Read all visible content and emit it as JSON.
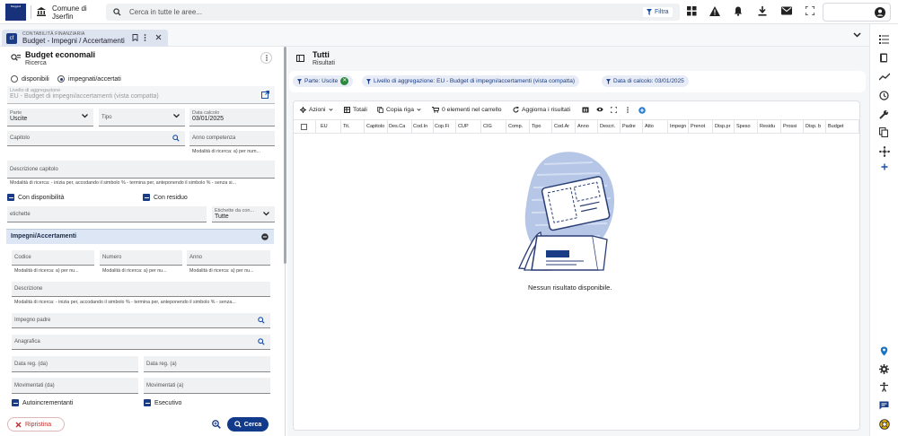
{
  "topbar": {
    "logo_text": "Maggioli",
    "comune_line1": "Comune di",
    "comune_line2": "Jserfin",
    "search_placeholder": "Cerca in tutte le aree...",
    "filtra_label": "Filtra"
  },
  "tab": {
    "badge": "cf",
    "category": "CONTABILITÀ FINANZIARIA",
    "title": "Budget - Impegni / Accertamenti"
  },
  "left": {
    "title": "Budget economali",
    "subtitle": "Ricerca",
    "radio_disponibili": "disponibili",
    "radio_impegnati": "impegnati/accertati",
    "livello": {
      "label": "Livello di aggregazione",
      "value": "EU - Budget di impegni/accertamenti (vista compatta)"
    },
    "parte": {
      "label": "Parte",
      "value": "Uscite"
    },
    "tipo": {
      "label": "Tipo"
    },
    "data_calcolo": {
      "label": "Data calcolo",
      "value": "03/01/2025"
    },
    "capitolo": {
      "placeholder": "Capitolo"
    },
    "anno_competenza": {
      "placeholder": "Anno competenza",
      "hint": "Modalità di ricerca: a) per num..."
    },
    "descrizione_capitolo": {
      "placeholder": "Descrizione capitolo",
      "hint": "Modalità di ricerca: - inizia per, accodando il simbolo % - termina per, anteponendo il simbolo % - senza si..."
    },
    "con_disponibilita": "Con disponibilità",
    "con_residuo": "Con residuo",
    "etichette": {
      "placeholder": "etichette"
    },
    "etichette_da": {
      "label": "Etichette da con...",
      "value": "Tutte"
    },
    "section_title": "Impegni/Accertamenti",
    "codice": {
      "placeholder": "Codice",
      "hint": "Modalità di ricerca: a) per nu..."
    },
    "numero": {
      "placeholder": "Numero",
      "hint": "Modalità di ricerca: a) per nu..."
    },
    "anno": {
      "placeholder": "Anno",
      "hint": "Modalità di ricerca: a) per nu..."
    },
    "descrizione": {
      "placeholder": "Descrizione",
      "hint": "Modalità di ricerca: - inizia per, accodando il simbolo % - termina per, anteponendo il simbolo % - senza..."
    },
    "impegno_padre": {
      "placeholder": "Impegno padre"
    },
    "anagrafica": {
      "placeholder": "Anagrafica"
    },
    "data_reg_da": {
      "placeholder": "Data reg. (da)"
    },
    "data_reg_a": {
      "placeholder": "Data reg. (a)"
    },
    "movimentati_da": {
      "placeholder": "Movimentati (da)"
    },
    "movimentati_a": {
      "placeholder": "Movimentati (a)"
    },
    "autoincrementanti": "Autoincrementanti",
    "esecutivo": "Esecutivo",
    "ripristina": "Ripristina",
    "cerca": "Cerca"
  },
  "right": {
    "title": "Tutti",
    "subtitle": "Risultati",
    "chips": [
      "Parte: Uscite",
      "Livello di aggregazione: EU - Budget di impegni/accertamenti (vista compatta)",
      "Data di calcolo: 03/01/2025"
    ],
    "toolbar": {
      "azioni": "Azioni",
      "totali": "Totali",
      "copia_riga": "Copia riga",
      "carrello": "0 elementi nel carrello",
      "aggiorna": "Aggiorna i risultati"
    },
    "columns": [
      "EU",
      "Tit.",
      "Capitolo",
      "Des.Ca",
      "Cod.In",
      "Cop.Fi",
      "CUP",
      "CIG",
      "Comp.",
      "Tipo",
      "Cod.Ar",
      "Anno",
      "Descri.",
      "Padre",
      "Atto",
      "Impegn",
      "Prenot",
      "Disp.pr",
      "Speso",
      "Residu",
      "Prossi",
      "Disp. b",
      "Budget"
    ],
    "empty_text": "Nessun risultato disponibile."
  },
  "colors": {
    "primary": "#123a8a",
    "danger": "#c12b2b",
    "chip_bg": "#e7ecf6",
    "success": "#2a8a3c"
  }
}
